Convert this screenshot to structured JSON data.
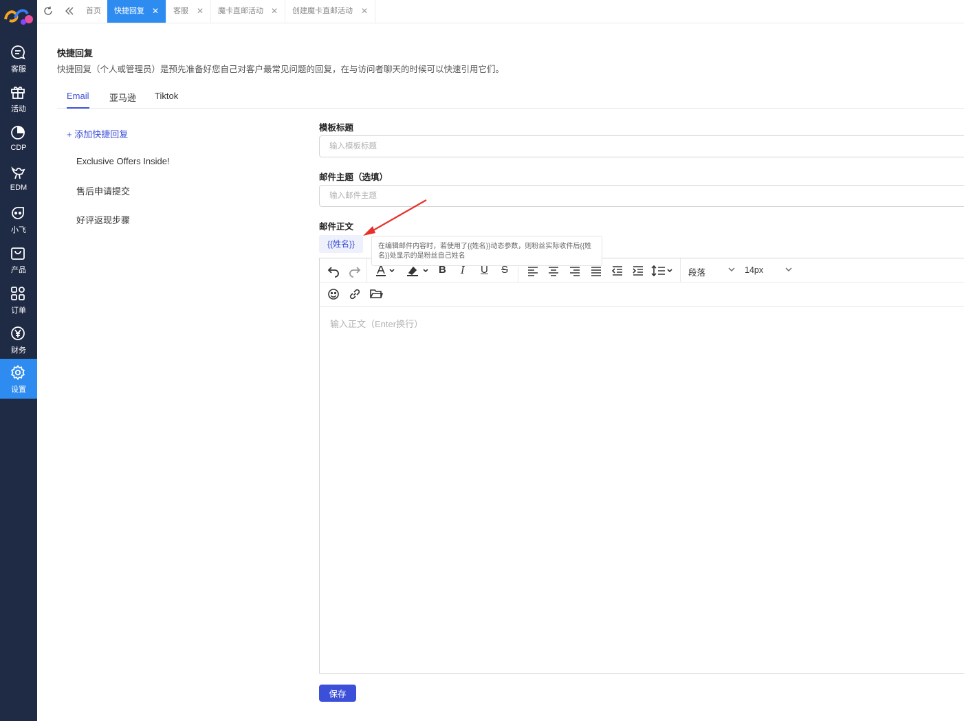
{
  "sidebar": {
    "items": [
      {
        "label": "客服",
        "icon": "chat-icon"
      },
      {
        "label": "活动",
        "icon": "gift-icon"
      },
      {
        "label": "CDP",
        "icon": "pie-chart-icon"
      },
      {
        "label": "EDM",
        "icon": "bird-icon"
      },
      {
        "label": "小飞",
        "icon": "robot-face-icon"
      },
      {
        "label": "产品",
        "icon": "shopping-bag-icon"
      },
      {
        "label": "订单",
        "icon": "grid-icon"
      },
      {
        "label": "财务",
        "icon": "yuan-icon"
      },
      {
        "label": "设置",
        "icon": "gear-icon",
        "active": true
      }
    ]
  },
  "tabs": [
    {
      "label": "首页"
    },
    {
      "label": "快捷回复",
      "active": true
    },
    {
      "label": "客服"
    },
    {
      "label": "魔卡直邮活动"
    },
    {
      "label": "创建魔卡直邮活动"
    }
  ],
  "page": {
    "title": "快捷回复",
    "description": "快捷回复（个人或管理员）是预先准备好您自己对客户最常见问题的回复，在与访问者聊天的时候可以快速引用它们。"
  },
  "platform_tabs": [
    "Email",
    "亚马逊",
    "Tiktok"
  ],
  "replies": {
    "add_label": "+ 添加快捷回复",
    "items": [
      "Exclusive Offers Inside!",
      "售后申请提交",
      "好评返现步骤"
    ]
  },
  "form": {
    "template_title_label": "模板标题",
    "template_title_placeholder": "输入模板标题",
    "subject_label": "邮件主题（选填）",
    "subject_placeholder": "输入邮件主题",
    "body_label": "邮件正文",
    "variable_chip": "{{姓名}}",
    "tooltip": "在编辑邮件内容时，若使用了{{姓名}}动态参数，则粉丝实际收件后{{姓名}}处显示的是粉丝自己姓名",
    "paragraph_select": "段落",
    "font_size_select": "14px",
    "body_placeholder": "输入正文（Enter换行）",
    "save_label": "保存"
  },
  "colors": {
    "sidebar_bg": "#1f2a44",
    "accent": "#2e8cf0",
    "primary": "#3b4fd8",
    "annotation_arrow": "#e8302a"
  }
}
